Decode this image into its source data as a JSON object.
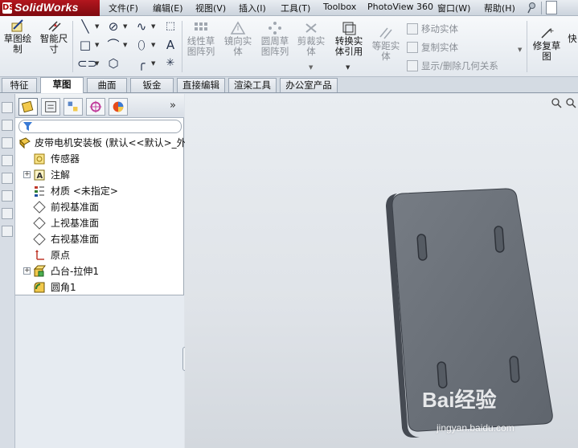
{
  "app": {
    "name": "SolidWorks"
  },
  "menu": {
    "items": [
      "文件(F)",
      "编辑(E)",
      "视图(V)",
      "插入(I)",
      "工具(T)",
      "Toolbox",
      "PhotoView 360",
      "窗口(W)",
      "帮助(H)"
    ]
  },
  "ribbon": {
    "sketch": "草图绘\n制",
    "smart_dim": "智能尺\n寸",
    "linear_pattern": "线性草\n图阵列",
    "mirror": "镜向实\n体",
    "circular_pattern": "圆周草\n图阵列",
    "trim": "剪裁实\n体",
    "convert": "转换实\n体引用",
    "offset": "等距实\n体",
    "move": "移动实体",
    "copy": "复制实体",
    "show_relations": "显示/删除几何关系",
    "repair": "修复草\n图",
    "quick": "快"
  },
  "tabs": [
    "特征",
    "草图",
    "曲面",
    "钣金",
    "直接编辑",
    "渲染工具",
    "办公室产品"
  ],
  "active_tab": "草图",
  "feature_tree": {
    "root": "皮带电机安装板 (默认<<默认>_外",
    "nodes": [
      "传感器",
      "注解",
      "材质 <未指定>",
      "前视基准面",
      "上视基准面",
      "右视基准面",
      "原点",
      "凸台-拉伸1",
      "圆角1"
    ]
  },
  "watermark": {
    "brand": "Bai经验",
    "url": "jingyan.baidu.com"
  },
  "colors": {
    "brand_red": "#a3121b",
    "plate_face": "#6e747c",
    "plate_edge": "#3b4048",
    "selection": "#2b6fd6"
  }
}
